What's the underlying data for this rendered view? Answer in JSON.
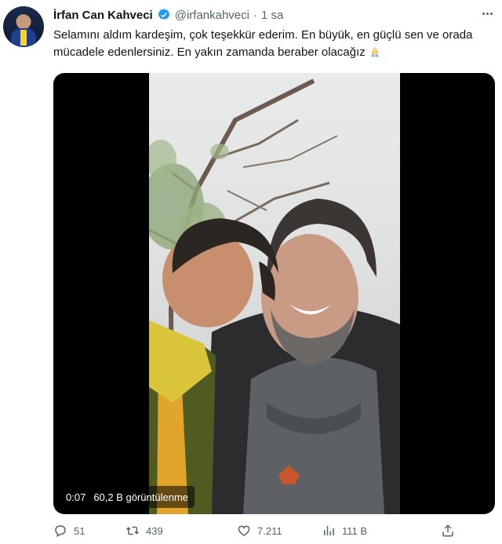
{
  "tweet": {
    "author_name": "İrfan Can Kahveci",
    "handle": "@irfankahveci",
    "separator": "·",
    "time": "1 sa",
    "text": "Selamını aldım kardeşim, çok teşekkür ederim. En büyük, en güçlü sen ve orada mücadele edenlersiniz. En yakın zamanda beraber olacağız",
    "emoji": "folded-hands-emoji"
  },
  "video": {
    "elapsed": "0:07",
    "views": "60,2 B görüntülenme"
  },
  "actions": {
    "replies": "51",
    "reposts": "439",
    "likes": "7.211",
    "views": "111 B"
  },
  "colors": {
    "verified": "#1d9bf0",
    "secondary_text": "#536471",
    "text": "#0f1419"
  },
  "icons": [
    "verified-badge-icon",
    "more-icon",
    "reply-icon",
    "repost-icon",
    "like-icon",
    "views-icon",
    "share-icon"
  ]
}
